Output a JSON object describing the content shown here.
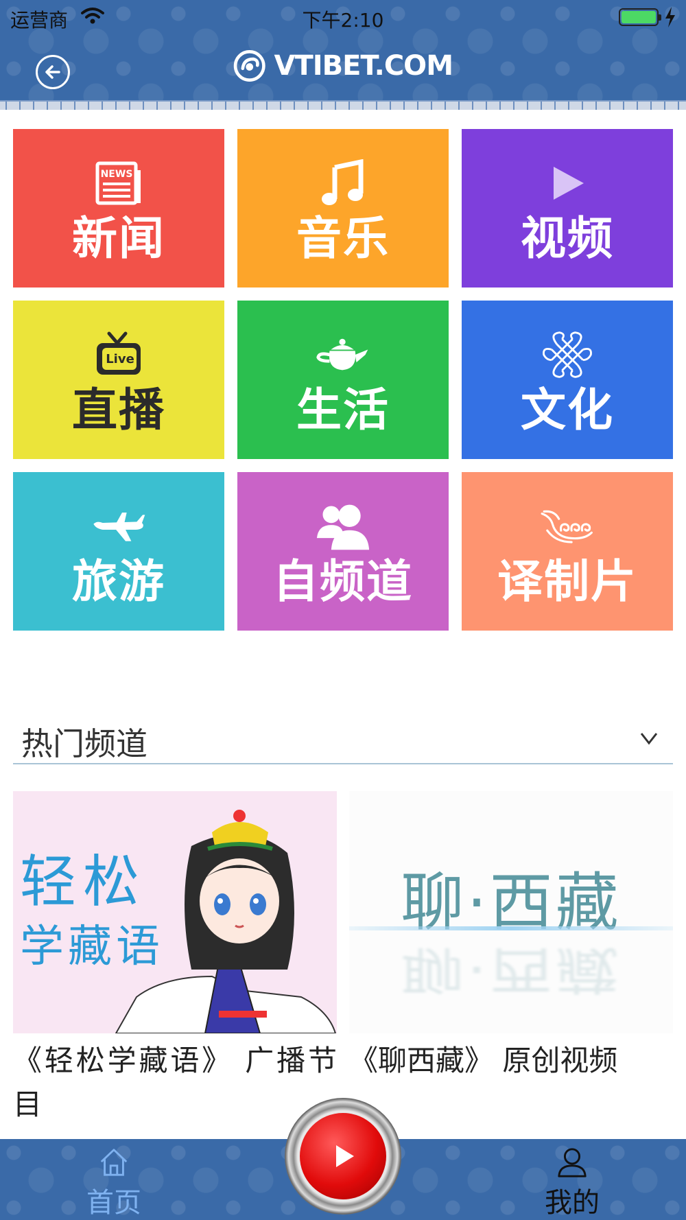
{
  "status_bar": {
    "carrier": "运营商",
    "time": "下午2:10"
  },
  "header": {
    "logo_text": "VTIBET.COM"
  },
  "categories": [
    {
      "label": "新闻",
      "color": "#f25249",
      "icon": "news-icon"
    },
    {
      "label": "音乐",
      "color": "#fda52a",
      "icon": "music-note-icon"
    },
    {
      "label": "视频",
      "color": "#7e3fdc",
      "icon": "play-icon"
    },
    {
      "label": "直播",
      "color": "#ebe43a",
      "icon": "live-tv-icon"
    },
    {
      "label": "生活",
      "color": "#2bbf4f",
      "icon": "teapot-icon"
    },
    {
      "label": "文化",
      "color": "#3471e4",
      "icon": "endless-knot-icon"
    },
    {
      "label": "旅游",
      "color": "#3bbfd0",
      "icon": "airplane-icon"
    },
    {
      "label": "自频道",
      "color": "#c963c7",
      "icon": "users-icon"
    },
    {
      "label": "译制片",
      "color": "#fe9470",
      "icon": "cloud-swirl-icon"
    }
  ],
  "hot_channels": {
    "title": "热门频道",
    "items": [
      {
        "caption": "《轻松学藏语》 广播节目",
        "thumb_text_1": "轻松",
        "thumb_text_2": "学藏语"
      },
      {
        "caption": "《聊西藏》 原创视频",
        "thumb_text": "聊·西藏"
      }
    ]
  },
  "tab_bar": {
    "home_label": "首页",
    "mine_label": "我的"
  },
  "colors": {
    "header_blue": "#3a6aa8",
    "active_tab": "#7fb2f0"
  }
}
